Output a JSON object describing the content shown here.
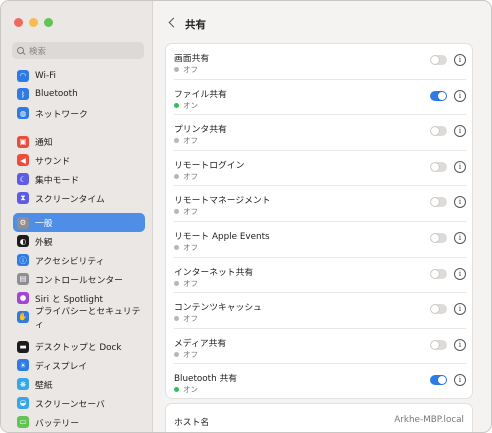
{
  "window": {
    "traffic_colors": [
      "#ee6a5f",
      "#f5bd4f",
      "#61c454"
    ]
  },
  "sidebar": {
    "search_placeholder": "検索",
    "groups": [
      [
        {
          "label": "Wi-Fi",
          "icon": "wifi-icon",
          "glyph": "◠",
          "color": "#2f7be6"
        },
        {
          "label": "Bluetooth",
          "icon": "bluetooth-icon",
          "glyph": "ᛒ",
          "color": "#2f7be6"
        },
        {
          "label": "ネットワーク",
          "icon": "network-globe-icon",
          "glyph": "◍",
          "color": "#2f7be6"
        }
      ],
      [
        {
          "label": "通知",
          "icon": "notifications-icon",
          "glyph": "▣",
          "color": "#eb4d3d"
        },
        {
          "label": "サウンド",
          "icon": "sound-icon",
          "glyph": "◀",
          "color": "#eb4d3d"
        },
        {
          "label": "集中モード",
          "icon": "focus-moon-icon",
          "glyph": "☾",
          "color": "#5e5ce6"
        },
        {
          "label": "スクリーンタイム",
          "icon": "screen-time-icon",
          "glyph": "⧗",
          "color": "#5e5ce6"
        }
      ],
      [
        {
          "label": "一般",
          "icon": "general-gear-icon",
          "glyph": "⚙",
          "color": "#8e8e93",
          "selected": true
        },
        {
          "label": "外観",
          "icon": "appearance-icon",
          "glyph": "◐",
          "color": "#1c1c1e"
        },
        {
          "label": "アクセシビリティ",
          "icon": "accessibility-icon",
          "glyph": "ⓘ",
          "color": "#2f7be6"
        },
        {
          "label": "コントロールセンター",
          "icon": "control-center-icon",
          "glyph": "▤",
          "color": "#8e8e93"
        },
        {
          "label": "Siri と Spotlight",
          "icon": "siri-icon",
          "glyph": "●",
          "color": "#a244d6"
        },
        {
          "label": "プライバシーとセキュリティ",
          "icon": "privacy-hand-icon",
          "glyph": "✋",
          "color": "#2f7be6"
        }
      ],
      [
        {
          "label": "デスクトップと Dock",
          "icon": "desktop-dock-icon",
          "glyph": "▬",
          "color": "#1c1c1e"
        },
        {
          "label": "ディスプレイ",
          "icon": "display-icon",
          "glyph": "☀",
          "color": "#2f7be6"
        },
        {
          "label": "壁紙",
          "icon": "wallpaper-icon",
          "glyph": "❋",
          "color": "#33a7e8"
        },
        {
          "label": "スクリーンセーバ",
          "icon": "screensaver-icon",
          "glyph": "◒",
          "color": "#33a7e8"
        },
        {
          "label": "バッテリー",
          "icon": "battery-icon",
          "glyph": "▭",
          "color": "#61c454"
        }
      ]
    ]
  },
  "header": {
    "title": "共有"
  },
  "sharing": {
    "on_color": "#31c15a",
    "off_color": "#b9b6b3",
    "services": [
      {
        "name": "画面共有",
        "status": "オフ",
        "on": false
      },
      {
        "name": "ファイル共有",
        "status": "オン",
        "on": true
      },
      {
        "name": "プリンタ共有",
        "status": "オフ",
        "on": false
      },
      {
        "name": "リモートログイン",
        "status": "オフ",
        "on": false
      },
      {
        "name": "リモートマネージメント",
        "status": "オフ",
        "on": false
      },
      {
        "name": "リモート Apple Events",
        "status": "オフ",
        "on": false
      },
      {
        "name": "インターネット共有",
        "status": "オフ",
        "on": false
      },
      {
        "name": "コンテンツキャッシュ",
        "status": "オフ",
        "on": false
      },
      {
        "name": "メディア共有",
        "status": "オフ",
        "on": false
      },
      {
        "name": "Bluetooth 共有",
        "status": "オン",
        "on": true
      }
    ]
  },
  "hostname": {
    "label": "ホスト名",
    "value": "Arkhe-MBP.local"
  }
}
